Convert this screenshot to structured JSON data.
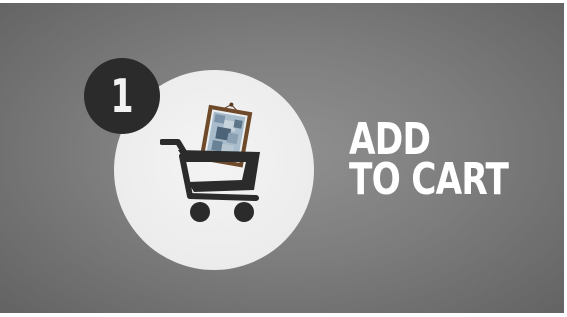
{
  "step": {
    "number": "1",
    "title_line1": "ADD",
    "title_line2": "TO CART",
    "icon": "shopping-cart-with-framed-picture"
  },
  "colors": {
    "background": "#7e7e7e",
    "circle": "#eeeeee",
    "badge": "#2b2b2b",
    "cart": "#2b2b2b",
    "text": "#ffffff",
    "frame": "#6e4a2a"
  }
}
